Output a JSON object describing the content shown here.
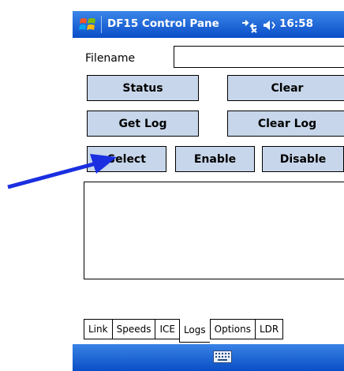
{
  "titlebar": {
    "title": "DF15 Control Pane",
    "clock": "16:58"
  },
  "form": {
    "filename_label": "Filename",
    "filename_value": ""
  },
  "buttons": {
    "status": "Status",
    "clear": "Clear",
    "get_log": "Get Log",
    "clear_log": "Clear Log",
    "select": "Select",
    "enable": "Enable",
    "disable": "Disable"
  },
  "tabs": [
    "Link",
    "Speeds",
    "ICE",
    "Logs",
    "Options",
    "LDR"
  ],
  "active_tab": "Logs",
  "colors": {
    "titlebar": "#1d64d8",
    "button_fill": "#c7d6ea",
    "annotation_arrow": "#1a2fe0"
  },
  "icons": [
    "windows-start-icon",
    "connectivity-icon",
    "volume-icon",
    "keyboard-icon",
    "annotation-arrow-icon"
  ]
}
